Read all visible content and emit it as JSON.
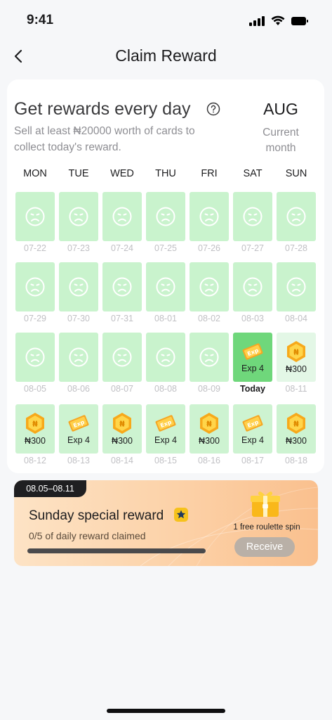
{
  "status_bar": {
    "time": "9:41"
  },
  "nav": {
    "title": "Claim Reward"
  },
  "header": {
    "headline": "Get rewards every day",
    "subtitle": "Sell at least ₦20000 worth of cards to collect today's reward.",
    "month": "AUG",
    "month_label": "Current month"
  },
  "weekdays": [
    "MON",
    "TUE",
    "WED",
    "THU",
    "FRI",
    "SAT",
    "SUN"
  ],
  "days": [
    {
      "date": "07-22",
      "state": "missed"
    },
    {
      "date": "07-23",
      "state": "missed"
    },
    {
      "date": "07-24",
      "state": "missed"
    },
    {
      "date": "07-25",
      "state": "missed"
    },
    {
      "date": "07-26",
      "state": "missed"
    },
    {
      "date": "07-27",
      "state": "missed"
    },
    {
      "date": "07-28",
      "state": "missed"
    },
    {
      "date": "07-29",
      "state": "missed"
    },
    {
      "date": "07-30",
      "state": "missed"
    },
    {
      "date": "07-31",
      "state": "missed"
    },
    {
      "date": "08-01",
      "state": "missed"
    },
    {
      "date": "08-02",
      "state": "missed"
    },
    {
      "date": "08-03",
      "state": "missed"
    },
    {
      "date": "08-04",
      "state": "missed"
    },
    {
      "date": "08-05",
      "state": "missed"
    },
    {
      "date": "08-06",
      "state": "missed"
    },
    {
      "date": "08-07",
      "state": "missed"
    },
    {
      "date": "08-08",
      "state": "missed"
    },
    {
      "date": "08-09",
      "state": "missed"
    },
    {
      "date": "Today",
      "state": "today",
      "reward": "exp",
      "reward_label": "Exp 4"
    },
    {
      "date": "08-11",
      "state": "upcoming-soft",
      "reward": "coin",
      "reward_label": "₦300"
    },
    {
      "date": "08-12",
      "state": "upcoming",
      "reward": "coin",
      "reward_label": "₦300"
    },
    {
      "date": "08-13",
      "state": "upcoming",
      "reward": "exp",
      "reward_label": "Exp 4"
    },
    {
      "date": "08-14",
      "state": "upcoming",
      "reward": "coin",
      "reward_label": "₦300"
    },
    {
      "date": "08-15",
      "state": "upcoming",
      "reward": "exp",
      "reward_label": "Exp 4"
    },
    {
      "date": "08-16",
      "state": "upcoming",
      "reward": "coin",
      "reward_label": "₦300"
    },
    {
      "date": "08-17",
      "state": "upcoming",
      "reward": "exp",
      "reward_label": "Exp 4"
    },
    {
      "date": "08-18",
      "state": "upcoming",
      "reward": "coin",
      "reward_label": "₦300"
    }
  ],
  "icons": {
    "missed": "sad-face-icon",
    "coin": "naira-coin-icon",
    "exp": "exp-ticket-icon",
    "help": "question-circle-icon",
    "gift": "gift-box-icon",
    "star": "star-badge-icon"
  },
  "colors": {
    "missed_tile": "#c9f3cd",
    "today_tile": "#6fd77b",
    "coin": "#f5a623",
    "banner_start": "#fde3c5",
    "banner_end": "#fac08e",
    "receive_disabled": "#b9b0a7"
  },
  "special_reward": {
    "period": "08.05–08.11",
    "title": "Sunday special reward",
    "progress_text": "0/5 of daily reward claimed",
    "progress_value": 0,
    "prize_label": "1 free roulette spin",
    "receive_label": "Receive"
  }
}
